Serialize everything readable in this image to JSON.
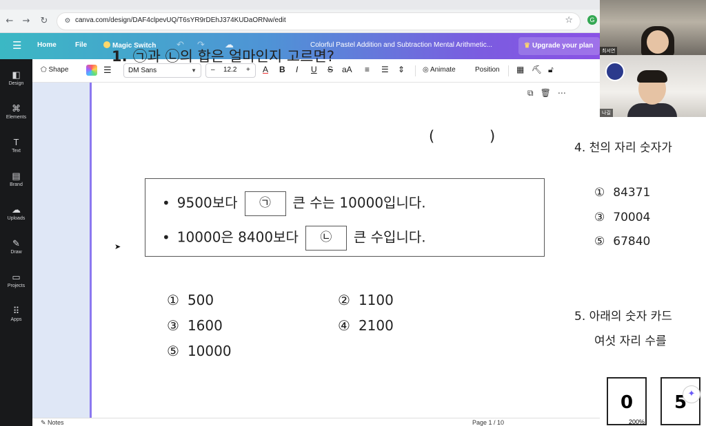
{
  "browser": {
    "url": "canva.com/design/DAF4clpevUQ/T6sYR9rDEhJ374KUDaORNw/edit"
  },
  "header": {
    "home": "Home",
    "file": "File",
    "magic_switch": "Magic Switch",
    "doc_title": "Colorful Pastel Addition and Subtraction Mental Arithmetic...",
    "upgrade": "Upgrade your plan"
  },
  "rail": [
    {
      "label": "Design",
      "icon": "design-icon"
    },
    {
      "label": "Elements",
      "icon": "elements-icon"
    },
    {
      "label": "Text",
      "icon": "text-icon"
    },
    {
      "label": "Brand",
      "icon": "brand-icon"
    },
    {
      "label": "Uploads",
      "icon": "uploads-icon"
    },
    {
      "label": "Draw",
      "icon": "draw-icon"
    },
    {
      "label": "Projects",
      "icon": "projects-icon"
    },
    {
      "label": "Apps",
      "icon": "apps-icon"
    }
  ],
  "toolbar": {
    "shape": "Shape",
    "font": "DM Sans",
    "font_size": "12.2",
    "minus": "–",
    "plus": "+",
    "animate": "Animate",
    "position": "Position",
    "case": "aA"
  },
  "question1": {
    "number": "1.",
    "text": "㉠과 ㉡의 합은 얼마인지 고르면?",
    "paren_open": "(",
    "paren_close": ")",
    "conditions": [
      {
        "before": "9500보다",
        "blank": "㉠",
        "after": "큰 수는 10000입니다."
      },
      {
        "before": "10000은 8400보다",
        "blank": "㉡",
        "after": "큰 수입니다."
      }
    ],
    "options": [
      {
        "mark": "①",
        "value": "500"
      },
      {
        "mark": "②",
        "value": "1100"
      },
      {
        "mark": "③",
        "value": "1600"
      },
      {
        "mark": "④",
        "value": "2100"
      },
      {
        "mark": "⑤",
        "value": "10000"
      }
    ]
  },
  "question4": {
    "title": "4. 천의 자리 숫자가",
    "options": [
      {
        "mark": "①",
        "value": "84371"
      },
      {
        "mark": "③",
        "value": "70004"
      },
      {
        "mark": "⑤",
        "value": "67840"
      }
    ]
  },
  "question5": {
    "title": "5. 아래의 숫자 카드",
    "line2": "여섯 자리 수를",
    "cards": [
      "0",
      "5"
    ]
  },
  "status": {
    "notes": "Notes",
    "page": "Page 1 / 10",
    "zoom": "200%"
  },
  "participants": [
    {
      "name": "최서연"
    },
    {
      "name": "나길"
    }
  ]
}
